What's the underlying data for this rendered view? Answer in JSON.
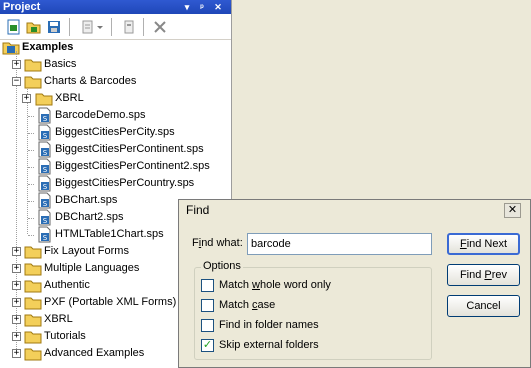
{
  "project_panel": {
    "title": "Project",
    "title_buttons": [
      "▾",
      "ᵖ",
      "✕"
    ],
    "toolbar_icons": [
      "new-project-icon",
      "open-project-icon",
      "save-project-icon",
      "add-files-icon",
      "add-files-dropdown-icon",
      "properties-icon",
      "remove-icon"
    ],
    "root_label": "Examples",
    "items": [
      {
        "label": "Basics",
        "type": "folder",
        "level": 1,
        "expander": "+"
      },
      {
        "label": "Charts & Barcodes",
        "type": "folder",
        "level": 1,
        "expander": "−"
      },
      {
        "label": "XBRL",
        "type": "folder",
        "level": 2,
        "expander": "+"
      },
      {
        "label": "BarcodeDemo.sps",
        "type": "file",
        "level": 2
      },
      {
        "label": "BiggestCitiesPerCity.sps",
        "type": "file",
        "level": 2
      },
      {
        "label": "BiggestCitiesPerContinent.sps",
        "type": "file",
        "level": 2
      },
      {
        "label": "BiggestCitiesPerContinent2.sps",
        "type": "file",
        "level": 2
      },
      {
        "label": "BiggestCitiesPerCountry.sps",
        "type": "file",
        "level": 2
      },
      {
        "label": "DBChart.sps",
        "type": "file",
        "level": 2
      },
      {
        "label": "DBChart2.sps",
        "type": "file",
        "level": 2
      },
      {
        "label": "HTMLTable1Chart.sps",
        "type": "file",
        "level": 2
      },
      {
        "label": "Fix Layout Forms",
        "type": "folder",
        "level": 1,
        "expander": "+"
      },
      {
        "label": "Multiple Languages",
        "type": "folder",
        "level": 1,
        "expander": "+"
      },
      {
        "label": "Authentic",
        "type": "folder",
        "level": 1,
        "expander": "+"
      },
      {
        "label": "PXF (Portable XML Forms)",
        "type": "folder",
        "level": 1,
        "expander": "+"
      },
      {
        "label": "XBRL",
        "type": "folder",
        "level": 1,
        "expander": "+"
      },
      {
        "label": "Tutorials",
        "type": "folder",
        "level": 1,
        "expander": "+"
      },
      {
        "label": "Advanced Examples",
        "type": "folder",
        "level": 1,
        "expander": "+"
      }
    ]
  },
  "find_dialog": {
    "title": "Find",
    "close_label": "✕",
    "find_what_label": "Find what:",
    "find_what_value": "barcode",
    "options_title": "Options",
    "options": [
      {
        "label": "Match whole word only",
        "checked": false
      },
      {
        "label": "Match case",
        "checked": false
      },
      {
        "label": "Find in folder names",
        "checked": false
      },
      {
        "label": "Skip external folders",
        "checked": true
      }
    ],
    "buttons": {
      "find_next": "Find Next",
      "find_prev": "Find Prev",
      "cancel": "Cancel"
    }
  },
  "colors": {
    "titlebar": "#2f59d1",
    "folder": "#f3cf5a",
    "file": "#2a6db5",
    "check": "#21a121"
  }
}
